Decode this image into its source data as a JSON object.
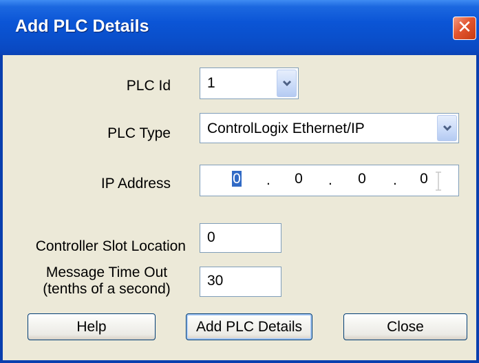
{
  "window": {
    "title": "Add PLC Details",
    "close_glyph": "✕"
  },
  "form": {
    "plc_id": {
      "label": "PLC Id",
      "value": "1"
    },
    "plc_type": {
      "label": "PLC Type",
      "value": "ControlLogix Ethernet/IP"
    },
    "ip_address": {
      "label": "IP Address",
      "octets": [
        "0",
        "0",
        "0",
        "0"
      ],
      "separator": "."
    },
    "slot": {
      "label": "Controller Slot Location",
      "value": "0"
    },
    "timeout": {
      "label_line1": "Message Time Out",
      "label_line2": "(tenths of a second)",
      "value": "30"
    }
  },
  "buttons": {
    "help": "Help",
    "add": "Add PLC Details",
    "close": "Close"
  },
  "colors": {
    "titlebar": "#0A4FCB",
    "dialog_bg": "#ECE9D8",
    "selection": "#316AC5"
  }
}
